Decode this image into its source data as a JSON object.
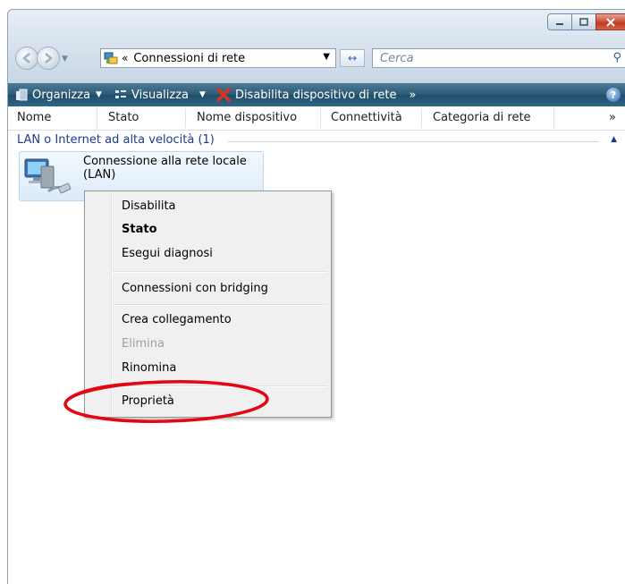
{
  "address": {
    "chevron": "«",
    "path": "Connessioni di rete"
  },
  "search": {
    "placeholder": "Cerca"
  },
  "toolbar": {
    "organize": "Organizza",
    "views": "Visualizza",
    "disable_device": "Disabilita dispositivo di rete",
    "more": "»"
  },
  "columns": [
    "Nome",
    "Stato",
    "Nome dispositivo",
    "Connettività",
    "Categoria di rete"
  ],
  "columns_more": "»",
  "group": {
    "header": "LAN o Internet ad alta velocità (1)"
  },
  "connection": {
    "name_line1": "Connessione alla rete locale",
    "name_line2": "(LAN)"
  },
  "context_menu": {
    "items": [
      {
        "label": "Disabilita",
        "style": "normal"
      },
      {
        "label": "Stato",
        "style": "bold"
      },
      {
        "label": "Esegui diagnosi",
        "style": "normal"
      },
      {
        "label": "Connessioni con bridging",
        "style": "normal"
      },
      {
        "label": "Crea collegamento",
        "style": "normal"
      },
      {
        "label": "Elimina",
        "style": "disabled"
      },
      {
        "label": "Rinomina",
        "style": "normal"
      },
      {
        "label": "Proprietà",
        "style": "normal"
      }
    ]
  },
  "colors": {
    "toolbar": "#2c5a76",
    "group_header_text": "#1e3a8a",
    "selection": "#dcebf9",
    "annotation_circle": "#e30613",
    "close_button": "#c23b22"
  }
}
